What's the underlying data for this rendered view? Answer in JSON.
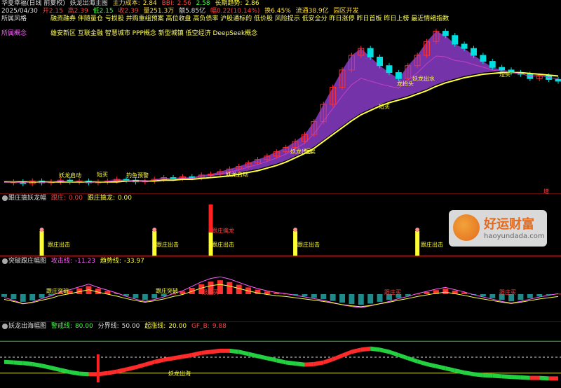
{
  "header": {
    "stock": "华夏幸福(日线 前复权)",
    "indicator": "妖龙出海主图",
    "zl_label": "主力成本:",
    "zl_val": "2.84",
    "bbi_label": "BBI:",
    "bbi_val": "2.56",
    "v3": "2.58",
    "trend_label": "长期趋势:",
    "trend_val": "2.86"
  },
  "info": {
    "date": "2025/04/30",
    "open": "开2.15",
    "high": "高2.39",
    "low": "低2.15",
    "close": "收2.39",
    "vol": "量251.3万",
    "amt": "额5.85亿",
    "chg": "幅0.22(10.14%)",
    "turn": "换6.45%",
    "float": "流通38.9亿",
    "tail": "园区开发"
  },
  "style_row": {
    "label": "所属风格",
    "text": "融资融券 伴随量仓 亏损股 并购重组预案 高位收盘 高负债率 沪股通标的 低价股 风险提示 低安全分 昨日涨停 昨日首板 昨日上榜 最近情绪指数"
  },
  "concept_row": {
    "label": "所属概念",
    "text": "雄安新区 互联金融 智慧城市 PPP概念 新型城镇 低空经济 DeepSeek概念"
  },
  "main_marks": {
    "dragon": [
      "妖龙启动",
      "妖龙启动"
    ],
    "fish": "钓鱼预警",
    "buy": [
      "短买",
      "短买",
      "短买"
    ],
    "sell": "短卖",
    "hu": [
      "妖龙出水",
      "妖龙出水"
    ],
    "lift": "龙抬头",
    "right": "增"
  },
  "panel2": {
    "title": "跟庄擒妖龙幅",
    "a_label": "跟庄:",
    "a_val": "0.00",
    "b_label": "跟庄擒龙:",
    "b_val": "0.00",
    "tag": "跟庄出击",
    "tag2": "跟庄擒龙"
  },
  "panel3": {
    "title": "突破跟庄幅图",
    "a_label": "攻击线:",
    "a_val": "-11.23",
    "b_label": "趋势线:",
    "b_val": "-33.97",
    "tag": "跟庄突破",
    "tag2": "跟庄买"
  },
  "panel4": {
    "title": "妖龙出海幅图",
    "a_label": "警戒线:",
    "a_val": "80.00",
    "b_label": "分界线:",
    "b_val": "50.00",
    "c_label": "起涨线:",
    "c_val": "20.00",
    "d_label": "GF_B:",
    "d_val": "9.88",
    "tag": "妖龙出海"
  },
  "watermark": {
    "t1": "好运财富",
    "t2": "haoyundada.com"
  },
  "colors": {
    "up": "#ff3030",
    "down": "#00e0e0",
    "ma": "#ffff40",
    "band": "#8a3cc8",
    "band2": "#e8e060",
    "panelLine": "#ff2020"
  },
  "chart_data": {
    "type": "line",
    "close": [
      2.14,
      2.15,
      2.13,
      2.16,
      2.14,
      2.15,
      2.17,
      2.15,
      2.16,
      2.14,
      2.15,
      2.16,
      2.18,
      2.17,
      2.15,
      2.16,
      2.18,
      2.2,
      2.19,
      2.21,
      2.2,
      2.23,
      2.24,
      2.27,
      2.3,
      2.33,
      2.37,
      2.41,
      2.45,
      2.5,
      2.55,
      2.62,
      2.7,
      2.85,
      3.05,
      3.25,
      3.45,
      3.62,
      3.7,
      3.6,
      3.5,
      3.42,
      3.35,
      3.5,
      3.62,
      3.78,
      3.9,
      3.85,
      3.75,
      3.7,
      3.62,
      3.55,
      3.48,
      3.45,
      3.42,
      3.4,
      3.35,
      3.38,
      3.34,
      3.32
    ],
    "long_trend": [
      2.15,
      2.15,
      2.15,
      2.15,
      2.15,
      2.15,
      2.15,
      2.15,
      2.15,
      2.15,
      2.15,
      2.15,
      2.15,
      2.16,
      2.16,
      2.16,
      2.16,
      2.17,
      2.17,
      2.18,
      2.18,
      2.19,
      2.2,
      2.21,
      2.22,
      2.24,
      2.26,
      2.28,
      2.31,
      2.34,
      2.38,
      2.43,
      2.48,
      2.54,
      2.62,
      2.7,
      2.78,
      2.86,
      2.93,
      2.98,
      3.03,
      3.07,
      3.1,
      3.13,
      3.17,
      3.21,
      3.26,
      3.3,
      3.33,
      3.36,
      3.38,
      3.4,
      3.41,
      3.42,
      3.42,
      3.42,
      3.41,
      3.4,
      3.39,
      3.38
    ],
    "panel3_bars": [
      -1.2,
      -2.2,
      -3.4,
      -2.8,
      -1.6,
      -0.6,
      0.8,
      1.6,
      2.6,
      3.6,
      2.4,
      1.4,
      0.4,
      -0.8,
      -1.8,
      -2.6,
      -1.9,
      -1.0,
      0.2,
      1.2,
      2.8,
      4.4,
      5.6,
      6.2,
      5.4,
      4.2,
      3.0,
      2.0,
      1.2,
      0.6,
      0.2,
      -0.4,
      -1.0,
      -1.6,
      -2.2,
      -3.0,
      -3.8,
      -4.4,
      -4.8,
      -4.2,
      -3.4,
      -2.6,
      -1.6,
      -0.8,
      0.2,
      1.0,
      1.8,
      2.4,
      1.6,
      0.8,
      -0.2,
      -1.0,
      -1.8,
      -2.6,
      -3.2,
      -2.6,
      -1.8,
      -1.0,
      -0.4,
      0.2
    ],
    "panel4_line": [
      45,
      44,
      43,
      41,
      38,
      34,
      30,
      26,
      23,
      22,
      22,
      24,
      27,
      31,
      35,
      40,
      45,
      49,
      52,
      55,
      58,
      62,
      64,
      66,
      66,
      64,
      60,
      56,
      52,
      48,
      44,
      42,
      40,
      41,
      44,
      50,
      57,
      64,
      68,
      70,
      68,
      64,
      58,
      52,
      46,
      41,
      37,
      33,
      29,
      25,
      22,
      20,
      19,
      18,
      17,
      16,
      15,
      15,
      14,
      14
    ],
    "ylim": [
      2.05,
      4.1
    ]
  }
}
